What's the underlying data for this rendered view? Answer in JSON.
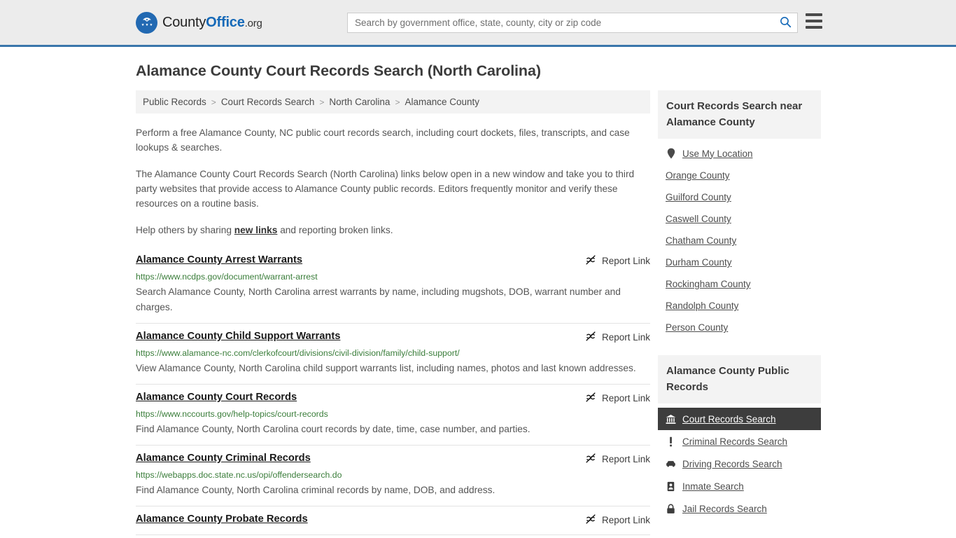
{
  "header": {
    "logo": {
      "icon": "eagle-stars-badge-icon",
      "text_part1": "County",
      "text_part2": "Office",
      "text_part3": ".org"
    },
    "search": {
      "placeholder": "Search by government office, state, county, city or zip code",
      "value": "",
      "button_icon": "search-icon"
    },
    "menu_icon": "hamburger-menu-icon",
    "accent_color": "#3a76ab"
  },
  "page_title": "Alamance County Court Records Search (North Carolina)",
  "breadcrumb": {
    "separator": ">",
    "items": [
      {
        "label": "Public Records"
      },
      {
        "label": "Court Records Search"
      },
      {
        "label": "North Carolina"
      },
      {
        "label": "Alamance County"
      }
    ]
  },
  "intro": {
    "p1": "Perform a free Alamance County, NC public court records search, including court dockets, files, transcripts, and case lookups & searches.",
    "p2": "The Alamance County Court Records Search (North Carolina) links below open in a new window and take you to third party websites that provide access to Alamance County public records. Editors frequently monitor and verify these resources on a routine basis.",
    "p3_before": "Help others by sharing ",
    "p3_link": "new links",
    "p3_after": " and reporting broken links."
  },
  "results": {
    "report_label": "Report Link",
    "report_icon": "broken-link-icon",
    "items": [
      {
        "title": "Alamance County Arrest Warrants",
        "url": "https://www.ncdps.gov/document/warrant-arrest",
        "description": "Search Alamance County, North Carolina arrest warrants by name, including mugshots, DOB, warrant number and charges."
      },
      {
        "title": "Alamance County Child Support Warrants",
        "url": "https://www.alamance-nc.com/clerkofcourt/divisions/civil-division/family/child-support/",
        "description": "View Alamance County, North Carolina child support warrants list, including names, photos and last known addresses."
      },
      {
        "title": "Alamance County Court Records",
        "url": "https://www.nccourts.gov/help-topics/court-records",
        "description": "Find Alamance County, North Carolina court records by date, time, case number, and parties."
      },
      {
        "title": "Alamance County Criminal Records",
        "url": "https://webapps.doc.state.nc.us/opi/offendersearch.do",
        "description": "Find Alamance County, North Carolina criminal records by name, DOB, and address."
      },
      {
        "title": "Alamance County Probate Records",
        "url": "",
        "description": ""
      }
    ]
  },
  "sidebar": {
    "nearby": {
      "title": "Court Records Search near Alamance County",
      "use_my_location": {
        "label": "Use My Location",
        "icon": "map-pin-icon"
      },
      "counties": [
        {
          "label": "Orange County"
        },
        {
          "label": "Guilford County"
        },
        {
          "label": "Caswell County"
        },
        {
          "label": "Chatham County"
        },
        {
          "label": "Durham County"
        },
        {
          "label": "Rockingham County"
        },
        {
          "label": "Randolph County"
        },
        {
          "label": "Person County"
        }
      ]
    },
    "public_records": {
      "title": "Alamance County Public Records",
      "active_index": 0,
      "items": [
        {
          "label": "Court Records Search",
          "icon": "bank-building-icon",
          "active": true
        },
        {
          "label": "Criminal Records Search",
          "icon": "exclamation-icon",
          "active": false
        },
        {
          "label": "Driving Records Search",
          "icon": "car-icon",
          "active": false
        },
        {
          "label": "Inmate Search",
          "icon": "id-card-icon",
          "active": false
        },
        {
          "label": "Jail Records Search",
          "icon": "lock-icon",
          "active": false
        }
      ]
    }
  }
}
